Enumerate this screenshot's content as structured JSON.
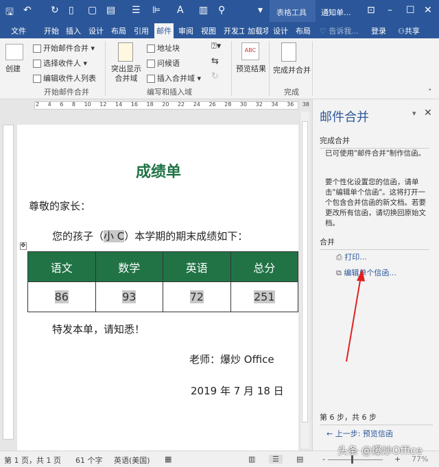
{
  "titlebar": {
    "context_tab": "表格工具",
    "doc_title": "通知单...",
    "accent": "#2b579a"
  },
  "tabs": [
    "文件",
    "开始",
    "插入",
    "设计",
    "布局",
    "引用",
    "邮件",
    "审阅",
    "视图",
    "开发工",
    "加载项",
    "设计",
    "布局"
  ],
  "tell_me": "告诉我...",
  "login": "登录",
  "share": "共享",
  "ribbon": {
    "create": "创建",
    "start_merge": "开始邮件合并",
    "select_recipients": "选择收件人",
    "edit_list": "编辑收件人列表",
    "group1": "开始邮件合并",
    "highlight": "突出显示合并域",
    "address": "地址块",
    "greeting": "问候语",
    "insert_field": "插入合并域",
    "group2": "编写和插入域",
    "preview": "预览结果",
    "finish": "完成并合并",
    "group3": "完成"
  },
  "ruler": [
    "2",
    "2",
    "4",
    "6",
    "8",
    "10",
    "12",
    "14",
    "16",
    "18",
    "20",
    "22",
    "24",
    "26",
    "28",
    "30",
    "32",
    "34",
    "36",
    "38"
  ],
  "doc": {
    "title": "成绩单",
    "greeting": "尊敬的家长：",
    "para": "您的孩子（",
    "name": "小 C",
    "para2": "）本学期的期末成绩如下：",
    "headers": [
      "语文",
      "数学",
      "英语",
      "总分"
    ],
    "scores": [
      "86",
      "93",
      "72",
      "251"
    ],
    "notice": "特发本单，请知悉！",
    "teacher": "老师：爆炒 Office",
    "date": "2019 年 7 月 18 日",
    "title_color": "#217346"
  },
  "pane": {
    "title": "邮件合并",
    "section1": "完成合并",
    "text1": "已可使用\"邮件合并\"制作信函。",
    "text2": "要个性化设置您的信函，请单击\"编辑单个信函\"。这将打开一个包含合并信函的新文档。若要更改所有信函，请切换回原始文档。",
    "section2": "合并",
    "print": "打印...",
    "edit_individual": "编辑单个信函...",
    "step": "第 6 步，共 6 步",
    "prev": "上一步: 预览信函"
  },
  "status": {
    "page": "第 1 页，共 1 页",
    "words": "61 个字",
    "lang": "英语(美国)",
    "zoom": "77%"
  },
  "watermark": "头条 @爆炒Office"
}
